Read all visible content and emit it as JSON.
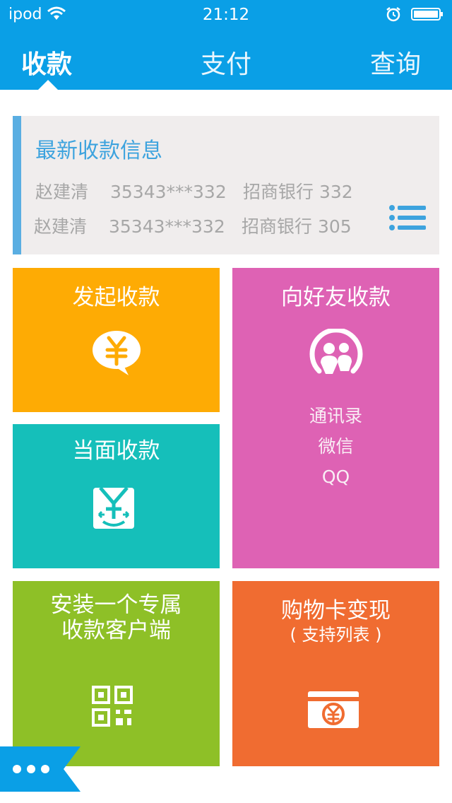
{
  "status_bar": {
    "carrier": "ipod",
    "time": "21:12"
  },
  "tabs": [
    {
      "label": "收款",
      "active": true
    },
    {
      "label": "支付",
      "active": false
    },
    {
      "label": "查询",
      "active": false
    }
  ],
  "latest": {
    "title": "最新收款信息",
    "rows": [
      {
        "name": "赵建清",
        "account": "35343***332",
        "bank": "招商银行 332"
      },
      {
        "name": "赵建清",
        "account": "35343***332",
        "bank": "招商银行 305"
      }
    ]
  },
  "tiles": {
    "initiate": {
      "title": "发起收款",
      "icon": "yuan-speech-bubble-icon"
    },
    "friends": {
      "title": "向好友收款",
      "icon": "contacts-icon",
      "options": [
        "通讯录",
        "微信",
        "QQ"
      ]
    },
    "face": {
      "title": "当面收款",
      "icon": "face-to-face-icon"
    },
    "install": {
      "title_line1": "安装一个专属",
      "title_line2": "收款客户端",
      "icon": "qr-code-icon"
    },
    "giftcard": {
      "title": "购物卡变现",
      "subtitle": "( 支持列表 )",
      "icon": "yuan-card-icon"
    }
  },
  "colors": {
    "header": "#0a9fe6",
    "orange": "#feab04",
    "pink": "#de62b4",
    "teal": "#15bfba",
    "green": "#8ec027",
    "red": "#f06c31",
    "accent": "#3da3de"
  }
}
